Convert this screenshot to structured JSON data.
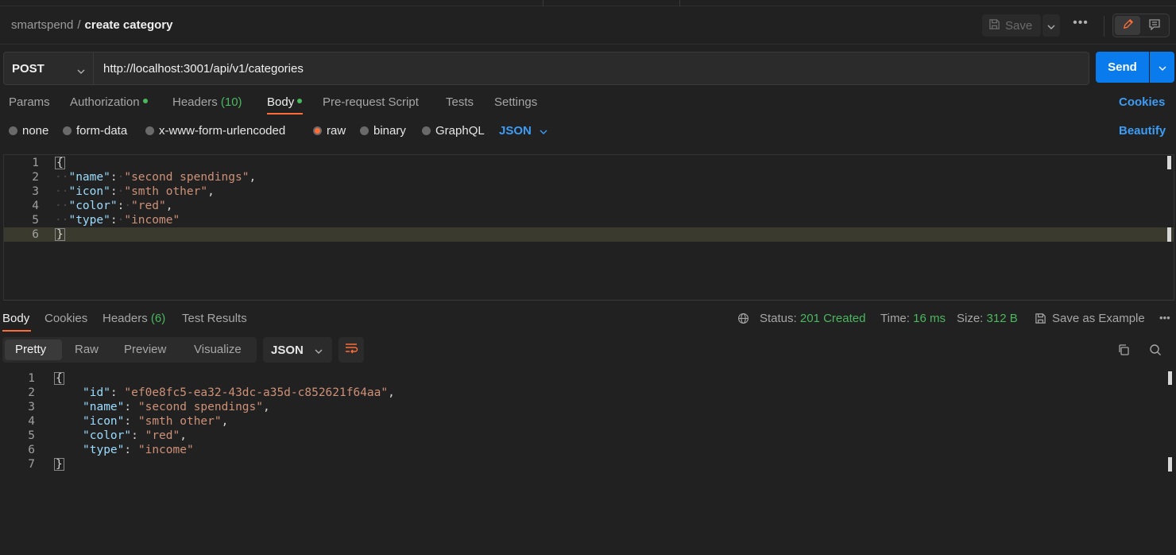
{
  "breadcrumb": {
    "collection": "smartspend",
    "separator": "/",
    "request": "create category"
  },
  "toolbar": {
    "save_label": "Save",
    "more_label": "•••"
  },
  "request": {
    "method": "POST",
    "url": "http://localhost:3001/api/v1/categories",
    "send_label": "Send"
  },
  "request_tabs": {
    "params": "Params",
    "authorization": "Authorization",
    "headers": "Headers",
    "headers_count": "(10)",
    "body": "Body",
    "prerequest": "Pre-request Script",
    "tests": "Tests",
    "settings": "Settings",
    "cookies": "Cookies"
  },
  "body_types": {
    "none": "none",
    "form_data": "form-data",
    "urlencoded": "x-www-form-urlencoded",
    "raw": "raw",
    "binary": "binary",
    "graphql": "GraphQL",
    "selected": "raw",
    "language": "JSON",
    "beautify": "Beautify"
  },
  "request_body": {
    "name": "second spendings",
    "icon": "smth other",
    "color": "red",
    "type": "income"
  },
  "response_tabs": {
    "body": "Body",
    "cookies": "Cookies",
    "headers": "Headers",
    "headers_count": "(6)",
    "test_results": "Test Results"
  },
  "response_meta": {
    "status_label": "Status:",
    "status_value": "201 Created",
    "time_label": "Time:",
    "time_value": "16 ms",
    "size_label": "Size:",
    "size_value": "312 B",
    "save_example": "Save as Example",
    "more_label": "•••"
  },
  "response_view": {
    "modes": [
      "Pretty",
      "Raw",
      "Preview",
      "Visualize"
    ],
    "active_mode": "Pretty",
    "format": "JSON"
  },
  "response_body": {
    "id": "ef0e8fc5-ea32-43dc-a35d-c852621f64aa",
    "name": "second spendings",
    "icon": "smth other",
    "color": "red",
    "type": "income"
  },
  "colors": {
    "accent_orange": "#ff6c37",
    "send_blue": "#097bed",
    "link_blue": "#3d9cf5",
    "status_green": "#49b85e",
    "json_key": "#9cdcfe",
    "json_string": "#ce9178"
  }
}
